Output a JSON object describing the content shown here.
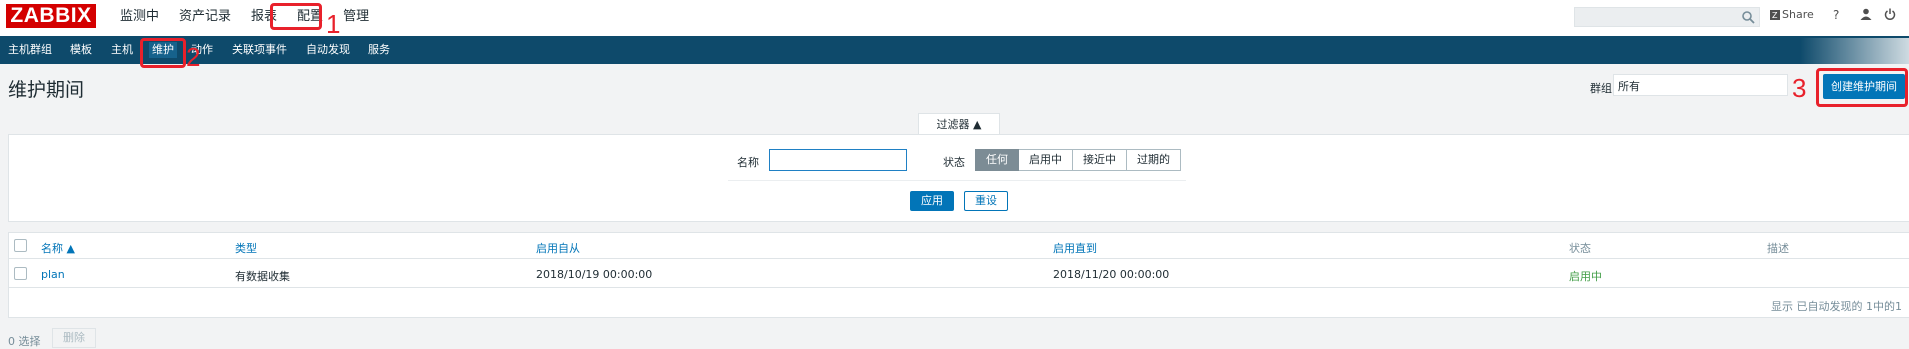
{
  "brand": "ZABBIX",
  "main_menu": [
    "监测中",
    "资产记录",
    "报表",
    "配置",
    "管理"
  ],
  "sub_menu": [
    "主机群组",
    "模板",
    "主机",
    "维护",
    "动作",
    "关联项事件",
    "自动发现",
    "服务"
  ],
  "header_tools": {
    "share": "Share",
    "help": "?"
  },
  "annotations": [
    "1",
    "2",
    "3"
  ],
  "page_title": "维护期间",
  "group_filter": {
    "label": "群组",
    "value": "所有"
  },
  "create_button": "创建维护期间",
  "filter": {
    "tab": "过滤器 ▲",
    "name_label": "名称",
    "name_value": "",
    "status_label": "状态",
    "status_options": [
      "任何",
      "启用中",
      "接近中",
      "过期的"
    ],
    "apply": "应用",
    "reset": "重设"
  },
  "table": {
    "columns": [
      "名称 ▲",
      "类型",
      "启用自从",
      "启用直到",
      "状态",
      "描述"
    ],
    "rows": [
      {
        "name": "plan",
        "type": "有数据收集",
        "since": "2018/10/19 00:00:00",
        "till": "2018/11/20 00:00:00",
        "status": "启用中",
        "description": ""
      }
    ],
    "footer": "显示 已自动发现的 1中的1"
  },
  "selection": {
    "count": "0 选择",
    "delete": "删除"
  },
  "colors": {
    "brand": "#d40000",
    "subnav": "#0e4a6b",
    "primary": "#0275b8",
    "annotation": "#e8212b",
    "active_status": "#429e47"
  }
}
